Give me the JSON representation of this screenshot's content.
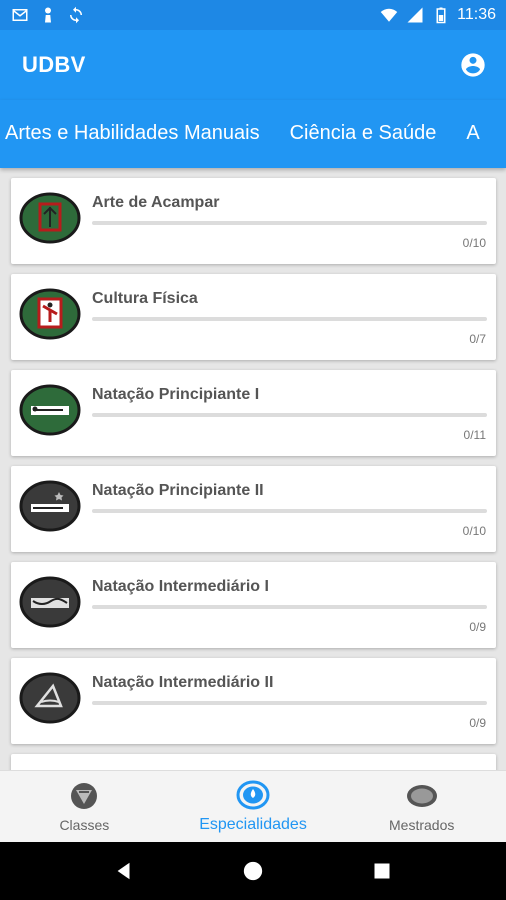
{
  "status_bar": {
    "time": "11:36",
    "left_icons": [
      "mail-icon",
      "pawn-icon",
      "sync-icon"
    ],
    "right_icons": [
      "wifi-icon",
      "signal-icon",
      "battery-icon"
    ]
  },
  "app": {
    "title": "UDBV",
    "account_icon": "account-circle-icon"
  },
  "tabs": [
    {
      "label": "Artes e Habilidades Manuais"
    },
    {
      "label": "Ciência e Saúde"
    },
    {
      "label": "A"
    }
  ],
  "specialties": [
    {
      "name": "Arte de Acampar",
      "count": "0/10",
      "progress": 0,
      "badge_color": "#2e6b3a"
    },
    {
      "name": "Cultura Física",
      "count": "0/7",
      "progress": 0,
      "badge_color": "#2e6b3a"
    },
    {
      "name": "Natação Principiante I",
      "count": "0/11",
      "progress": 0,
      "badge_color": "#2e6b3a"
    },
    {
      "name": "Natação Principiante II",
      "count": "0/10",
      "progress": 0,
      "badge_color": "#3a3a3a"
    },
    {
      "name": "Natação Intermediário I",
      "count": "0/9",
      "progress": 0,
      "badge_color": "#3a3a3a"
    },
    {
      "name": "Natação Intermediário II",
      "count": "0/9",
      "progress": 0,
      "badge_color": "#3a3a3a"
    }
  ],
  "bottom_nav": [
    {
      "label": "Classes",
      "icon": "shield-icon",
      "active": false
    },
    {
      "label": "Especialidades",
      "icon": "badge-icon",
      "active": true
    },
    {
      "label": "Mestrados",
      "icon": "oval-badge-icon",
      "active": false
    }
  ],
  "colors": {
    "primary": "#2196f3",
    "status_bar": "#1e88e5",
    "badge_border": "#b71c1c"
  }
}
